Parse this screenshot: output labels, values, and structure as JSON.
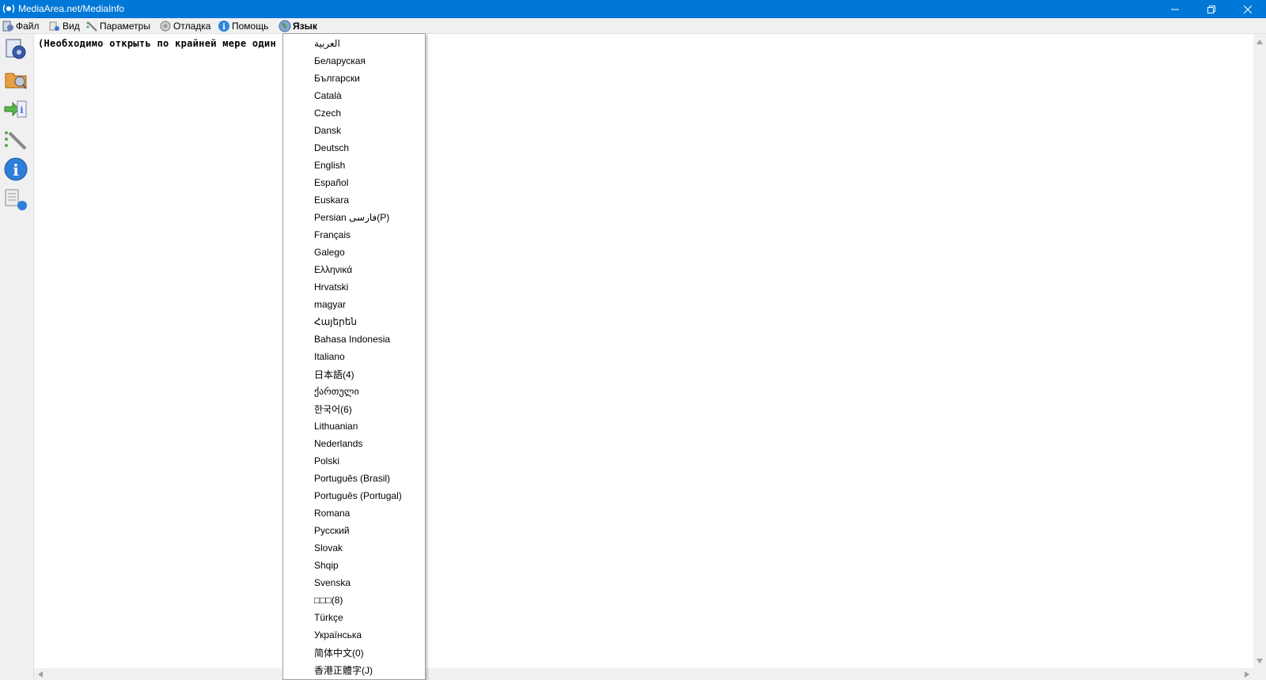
{
  "window": {
    "title": "MediaArea.net/MediaInfo",
    "controls": {
      "minimize": "minimize-icon",
      "maximize": "restore-icon",
      "close": "close-icon"
    }
  },
  "menubar": {
    "items": [
      {
        "label": "Файл",
        "icon": "file-icon"
      },
      {
        "label": "Вид",
        "icon": "view-icon"
      },
      {
        "label": "Параметры",
        "icon": "options-icon"
      },
      {
        "label": "Отладка",
        "icon": "debug-icon"
      },
      {
        "label": "Помощь",
        "icon": "help-icon"
      },
      {
        "label": "Язык",
        "icon": "globe-icon"
      }
    ]
  },
  "toolbar": {
    "buttons": [
      {
        "name": "open-file-icon"
      },
      {
        "name": "open-folder-icon"
      },
      {
        "name": "export-icon"
      },
      {
        "name": "preferences-icon"
      },
      {
        "name": "about-icon"
      },
      {
        "name": "knowledge-base-icon"
      }
    ]
  },
  "content": {
    "text": "(Необходимо открыть по крайней мере один файл)"
  },
  "language_menu": {
    "items": [
      "العربية",
      "Беларуская",
      "Български",
      "Català",
      "Czech",
      "Dansk",
      "Deutsch",
      "English",
      "Español",
      "Euskara",
      "Persian فارسی(P)",
      "Français",
      "Galego",
      "Ελληνικά",
      "Hrvatski",
      "magyar",
      "Հայերեն",
      "Bahasa Indonesia",
      "Italiano",
      "日本語(4)",
      "ქართული",
      "한국어(6)",
      "Lithuanian",
      "Nederlands",
      "Polski",
      "Português (Brasil)",
      "Português (Portugal)",
      "Romana",
      "Русский",
      "Slovak",
      "Shqip",
      "Svenska",
      "□□□(8)",
      "Türkçe",
      "Українська",
      "简体中文(0)",
      "香港正體字(J)"
    ]
  },
  "colors": {
    "titlebar": "#0078d7",
    "menubar": "#f0f0f0",
    "background": "#ffffff"
  }
}
